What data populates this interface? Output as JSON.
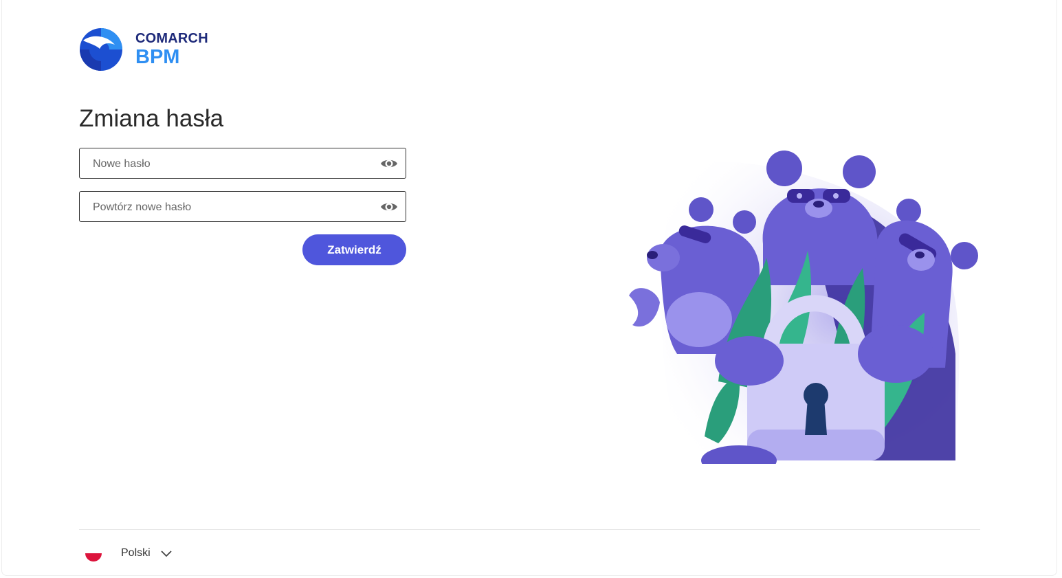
{
  "brand": {
    "company": "COMARCH",
    "product": "BPM"
  },
  "form": {
    "title": "Zmiana hasła",
    "new_password_placeholder": "Nowe hasło",
    "repeat_password_placeholder": "Powtórz nowe hasło",
    "submit_label": "Zatwierdź"
  },
  "footer": {
    "language_label": "Polski"
  },
  "colors": {
    "accent": "#4f56dc",
    "brand_dark": "#1e2a7a",
    "brand_light": "#2f8ff2",
    "illustration_purple": "#5f55c9",
    "illustration_green": "#2a9e7b"
  },
  "icons": {
    "show_password": "eye-icon",
    "language_flag": "poland-flag-icon",
    "dropdown": "chevron-down-icon"
  }
}
